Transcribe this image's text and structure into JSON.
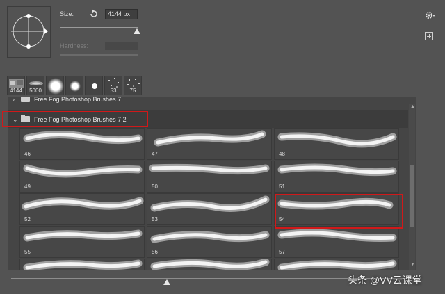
{
  "settings": {
    "size_label": "Size:",
    "size_value": "4144 px",
    "size_level": 0.95,
    "hardness_label": "Hardness:",
    "hardness_value": ""
  },
  "recent_brushes": [
    {
      "label": "4144",
      "icon": "fog-thumb"
    },
    {
      "label": "5000",
      "icon": "fog-thumb"
    },
    {
      "label": "",
      "icon": "soft-round-large"
    },
    {
      "label": "",
      "icon": "soft-round-medium"
    },
    {
      "label": "",
      "icon": "hard-round-small"
    },
    {
      "label": "53",
      "icon": "scatter"
    },
    {
      "label": "75",
      "icon": "scatter"
    }
  ],
  "groups": {
    "previous": "Free Fog Photoshop Brushes 7",
    "current": "Free Fog Photoshop Brushes 7 2"
  },
  "brushes": [
    {
      "label": "46"
    },
    {
      "label": "47"
    },
    {
      "label": "48"
    },
    {
      "label": "49"
    },
    {
      "label": "50"
    },
    {
      "label": "51"
    },
    {
      "label": "52"
    },
    {
      "label": "53"
    },
    {
      "label": "54"
    },
    {
      "label": "55"
    },
    {
      "label": "56"
    },
    {
      "label": "57"
    },
    {
      "label": ""
    },
    {
      "label": ""
    },
    {
      "label": ""
    }
  ],
  "highlight_color": "#d0191a",
  "watermark": "头条 @VV云课堂"
}
